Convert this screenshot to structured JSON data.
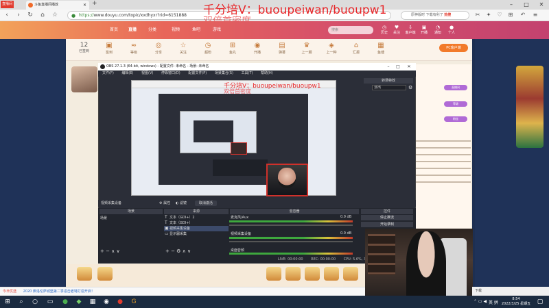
{
  "browser": {
    "live_badge": "直播间",
    "tab_title": "斗鱼直播间播放",
    "url_scheme": "https://",
    "url_rest": "www.douyu.com/topic/xxdhyxr?rid=6151888",
    "search_text": "原神版时 下载有利了",
    "search_hot": "热搜"
  },
  "watermark": {
    "line1": "千分培V：buoupeiwan/buoupw1",
    "line2": "双倍首密度",
    "small1": "千分培V：buoupeiwan/buoupw1",
    "small2": "双倍首密度"
  },
  "site": {
    "nav": [
      "首页",
      "直播",
      "分类",
      "视频",
      "鱼吧",
      "游戏"
    ],
    "search_placeholder": "搜索",
    "header_icons": [
      "历史",
      "关注",
      "客户端",
      "开播",
      "通知",
      "个人"
    ]
  },
  "tasks": {
    "date_day": "12",
    "date_label": "已签到",
    "items": [
      "签到",
      "等级",
      "分享",
      "关注",
      "超粉",
      "鱼丸",
      "开播",
      "弹幕",
      "上一期",
      "上一种",
      "汇报",
      "鱼塘"
    ],
    "pc_button": "PC客户端"
  },
  "obs": {
    "title": "OBS 27.1.3 (64-bit, windows) - 配置文件: 未命名 - 场景: 未命名",
    "menu": [
      "文件(F)",
      "编辑(E)",
      "视图(V)",
      "停靠窗口(D)",
      "配置文件(P)",
      "场景集合(S)",
      "工具(T)",
      "帮助(H)"
    ],
    "right_dock_title": "转场特效",
    "transition_select": "淡出",
    "properties_tab": "属性",
    "filters_tab": "滤镜",
    "source_header_label": "视频采集设备",
    "deactivate_button": "取消激活",
    "docks": {
      "scenes": "场景",
      "sources": "来源",
      "mixer": "混音器",
      "controls": "控件"
    },
    "scene_item": "场景",
    "sources": [
      {
        "icon": "text-icon",
        "label": "文本（GDI+）2"
      },
      {
        "icon": "text-icon",
        "label": "文本（GDI+）"
      },
      {
        "icon": "camera-icon",
        "label": "视频采集设备"
      },
      {
        "icon": "monitor-icon",
        "label": "显示器采集"
      }
    ],
    "mixer_channels": [
      {
        "name": "麦克风/Aux",
        "db": "0.0 dB"
      },
      {
        "name": "视频采集设备",
        "db": "0.0 dB"
      },
      {
        "name": "桌面音频",
        "db": ""
      }
    ],
    "controls": [
      "停止推流",
      "开始录制"
    ],
    "status": {
      "live": "LIVE: 00:00:00",
      "rec": "REC: 00:00:00",
      "cpu": "CPU: 5.6%, 30.00 fps",
      "kbps": "kb/s: 0"
    }
  },
  "chat": {
    "buttons": [
      "直播间",
      "等级",
      "粉丝"
    ]
  },
  "news": {
    "tag": "今日优选",
    "headline": "2020 弗洛伦萨城堡第二季进击者特打造开启！"
  },
  "taskbar": {
    "time": "8:54",
    "date": "2022/3/25 星期五",
    "tray_text": "英 拼",
    "download_text": "下载"
  }
}
